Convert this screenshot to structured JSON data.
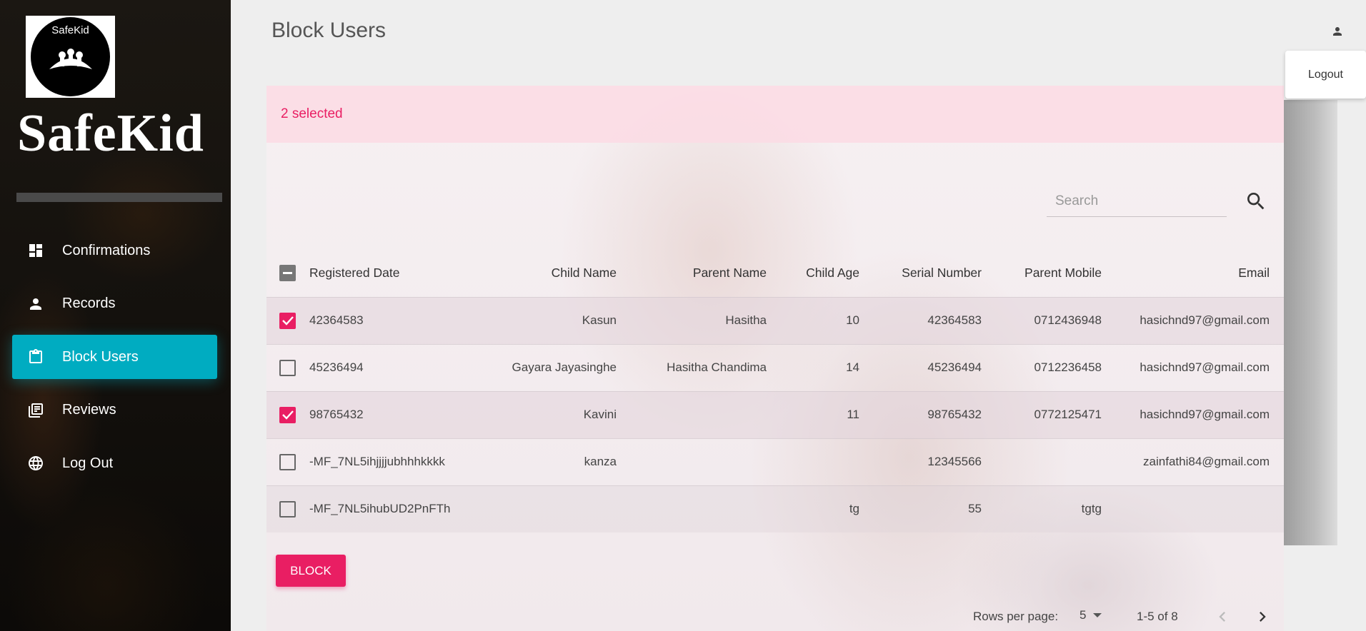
{
  "sidebar": {
    "logo_text": "SafeKid",
    "brand": "SafeKid",
    "items": [
      {
        "label": "Confirmations",
        "icon": "dashboard-icon"
      },
      {
        "label": "Records",
        "icon": "person-icon"
      },
      {
        "label": "Block Users",
        "icon": "clipboard-icon",
        "active": true
      },
      {
        "label": "Reviews",
        "icon": "library-books-icon"
      },
      {
        "label": "Log Out",
        "icon": "globe-icon"
      }
    ]
  },
  "header": {
    "title": "Block Users",
    "logout_label": "Logout"
  },
  "toolbar": {
    "selected_text": "2 selected",
    "search_placeholder": "Search"
  },
  "table": {
    "columns": [
      "Registered Date",
      "Child Name",
      "Parent Name",
      "Child Age",
      "Serial Number",
      "Parent Mobile",
      "Email"
    ],
    "rows": [
      {
        "checked": true,
        "date": "42364583",
        "child": "Kasun",
        "parent": "Hasitha",
        "age": "10",
        "serial": "42364583",
        "mobile": "0712436948",
        "email": "hasichnd97@gmail.com"
      },
      {
        "checked": false,
        "date": "45236494",
        "child": "Gayara Jayasinghe",
        "parent": "Hasitha Chandima",
        "age": "14",
        "serial": "45236494",
        "mobile": "0712236458",
        "email": "hasichnd97@gmail.com"
      },
      {
        "checked": true,
        "date": "98765432",
        "child": "Kavini",
        "parent": "",
        "age": "11",
        "serial": "98765432",
        "mobile": "0772125471",
        "email": "hasichnd97@gmail.com"
      },
      {
        "checked": false,
        "date": "-MF_7NL5ihjjjjubhhhkkkk",
        "child": "kanza",
        "parent": "",
        "age": "",
        "serial": "12345566",
        "mobile": "",
        "email": "zainfathi84@gmail.com"
      },
      {
        "checked": false,
        "date": "-MF_7NL5ihubUD2PnFTh",
        "child": "",
        "parent": "",
        "age": "tg",
        "serial": "55",
        "mobile": "tgtg",
        "email": ""
      }
    ]
  },
  "actions": {
    "block_label": "BLOCK"
  },
  "pagination": {
    "rows_per_page_label": "Rows per page:",
    "rows_per_page_value": "5",
    "page_info": "1-5 of 8"
  },
  "colors": {
    "accent": "#e91e63",
    "active_nav": "#00acc1"
  }
}
